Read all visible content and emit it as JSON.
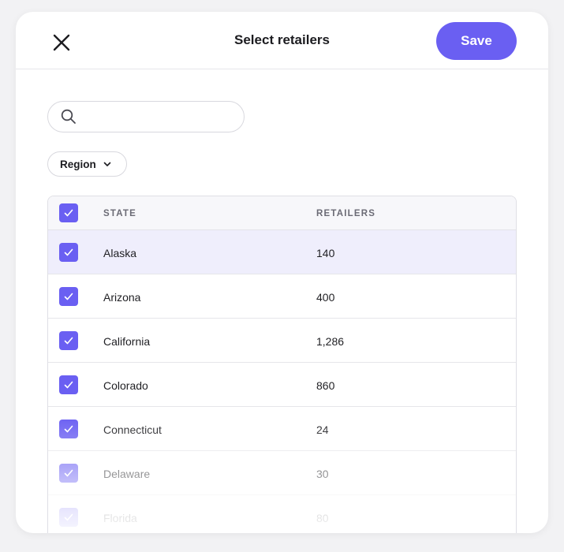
{
  "header": {
    "title": "Select retailers",
    "save_label": "Save",
    "close_icon": "close-icon"
  },
  "search": {
    "value": "",
    "placeholder": "",
    "icon": "search-icon"
  },
  "filters": {
    "region_label": "Region",
    "region_icon": "chevron-down-icon"
  },
  "table": {
    "columns": {
      "state": "STATE",
      "retailers": "RETAILERS"
    },
    "select_all_checked": true,
    "rows": [
      {
        "state": "Alaska",
        "retailers": "140",
        "checked": true,
        "highlighted": true
      },
      {
        "state": "Arizona",
        "retailers": "400",
        "checked": true
      },
      {
        "state": "California",
        "retailers": "1,286",
        "checked": true
      },
      {
        "state": "Colorado",
        "retailers": "860",
        "checked": true
      },
      {
        "state": "Connecticut",
        "retailers": "24",
        "checked": true
      },
      {
        "state": "Delaware",
        "retailers": "30",
        "checked": true
      },
      {
        "state": "Florida",
        "retailers": "80",
        "checked": true
      }
    ]
  },
  "colors": {
    "accent": "#6a5ff2",
    "selected_row": "#efeefc",
    "header_bg": "#f7f7fa"
  }
}
